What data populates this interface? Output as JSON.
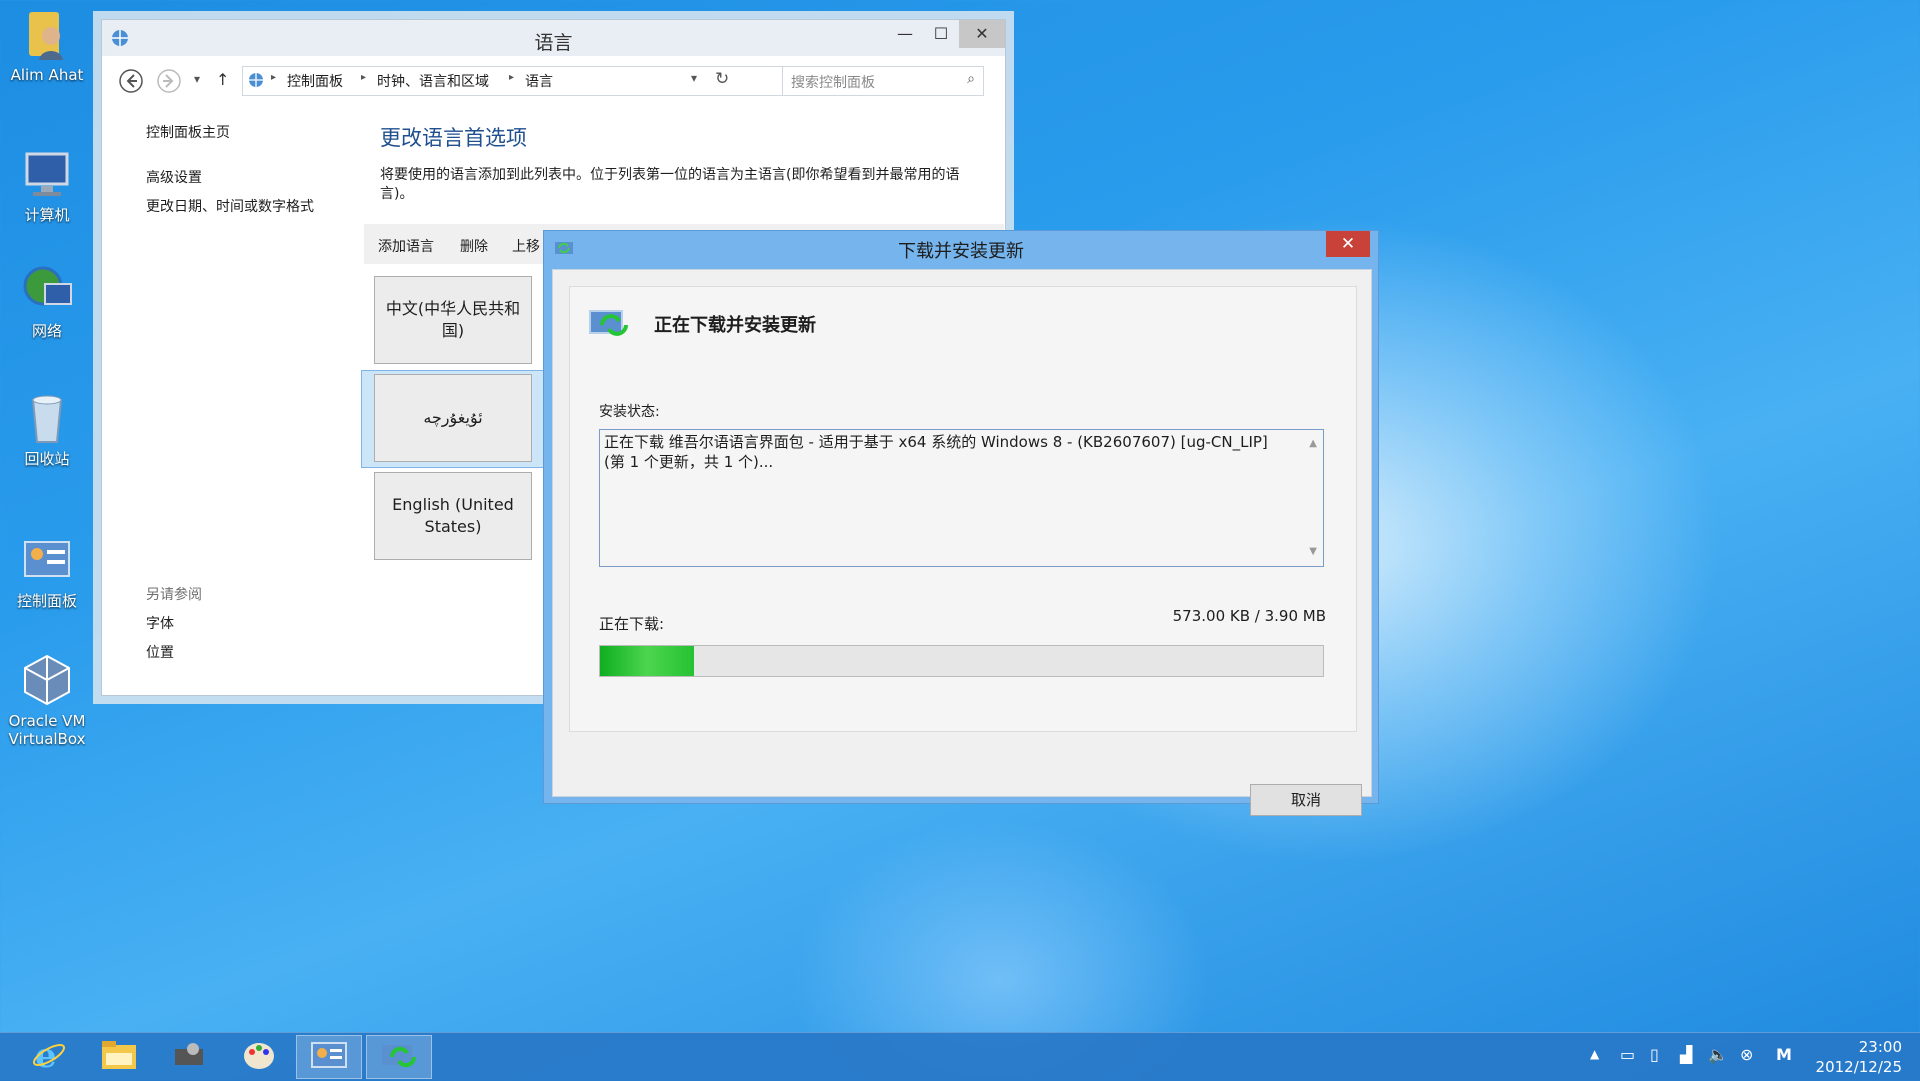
{
  "desktop": {
    "icons": [
      {
        "label": "Alim Ahat",
        "icon": "user-folder-icon"
      },
      {
        "label": "计算机",
        "icon": "computer-icon"
      },
      {
        "label": "网络",
        "icon": "network-icon"
      },
      {
        "label": "回收站",
        "icon": "recycle-bin-icon"
      },
      {
        "label": "控制面板",
        "icon": "control-panel-icon"
      },
      {
        "label": "Oracle VM VirtualBox",
        "icon": "virtualbox-icon"
      }
    ]
  },
  "language_window": {
    "title": "语言",
    "breadcrumb": [
      "控制面板",
      "时钟、语言和区域",
      "语言"
    ],
    "search_placeholder": "搜索控制面板",
    "left_nav": {
      "home": "控制面板主页",
      "advanced": "高级设置",
      "datetime": "更改日期、时间或数字格式",
      "see_also": "另请参阅",
      "fonts": "字体",
      "location": "位置"
    },
    "heading": "更改语言首选项",
    "description": "将要使用的语言添加到此列表中。位于列表第一位的语言为主语言(即你希望看到并最常用的语言)。",
    "toolbar": {
      "add": "添加语言",
      "remove": "删除",
      "up": "上移"
    },
    "languages": [
      "中文(中华人民共和国)",
      "ئۇيغۇرچە",
      "English (United States)"
    ]
  },
  "update_dialog": {
    "title": "下载并安装更新",
    "heading": "正在下载并安装更新",
    "status_label": "安装状态:",
    "status_text": "正在下载 维吾尔语语言界面包 - 适用于基于 x64 系统的 Windows 8 - (KB2607607) [ug-CN_LIP](第 1 个更新，共 1 个)...",
    "downloading_label": "正在下载:",
    "size_text": "573.00 KB / 3.90 MB",
    "progress_fraction": 0.13,
    "cancel_label": "取消"
  },
  "taskbar": {
    "items": [
      "internet-explorer-icon",
      "file-explorer-icon",
      "system-tool-icon",
      "paint-icon",
      "control-panel-icon",
      "windows-update-icon"
    ],
    "tray_icons": [
      "show-hidden-icon",
      "keyboard-icon",
      "device-icon",
      "signal-icon",
      "volume-icon",
      "close-circle-icon",
      "ime-icon"
    ],
    "ime_label": "M",
    "time": "23:00",
    "date": "2012/12/25"
  },
  "colors": {
    "accent": "#2a9cec",
    "link": "#1e5fa8",
    "progress": "#26c233",
    "close": "#c9423a"
  }
}
